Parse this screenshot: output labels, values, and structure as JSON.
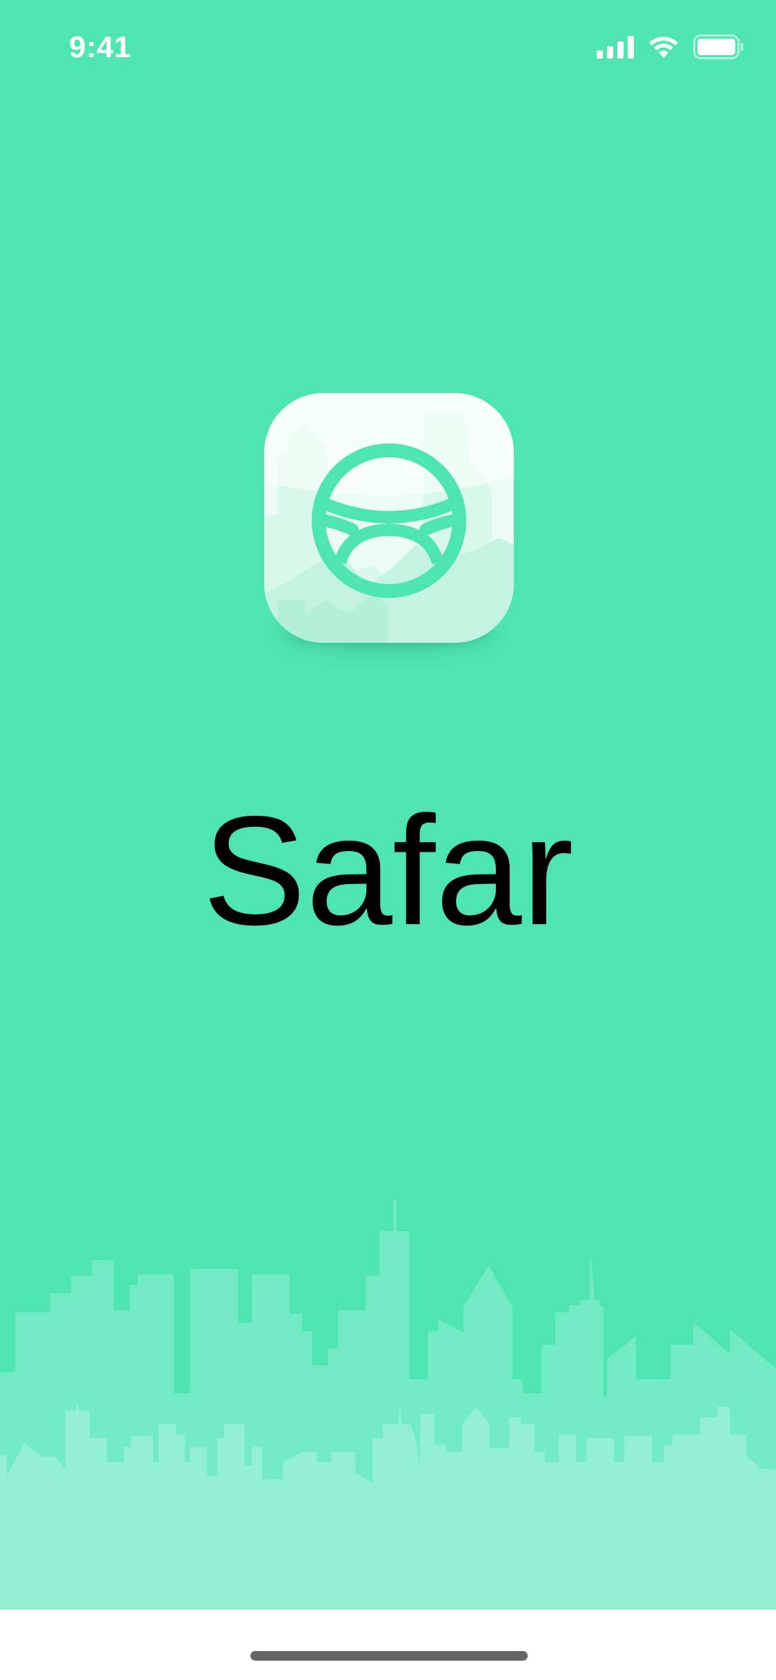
{
  "status_bar": {
    "time": "9:41",
    "icons": [
      "cellular-signal-icon",
      "wifi-icon",
      "battery-icon"
    ]
  },
  "app": {
    "name": "Safar",
    "icon": "steering-wheel-icon"
  },
  "colors": {
    "background": "#4fe5b2",
    "title_text": "#000000",
    "status_text": "#ffffff",
    "skyline_back": "#72ebc5",
    "skyline_front": "#93efd1",
    "home_indicator": "#666666"
  }
}
